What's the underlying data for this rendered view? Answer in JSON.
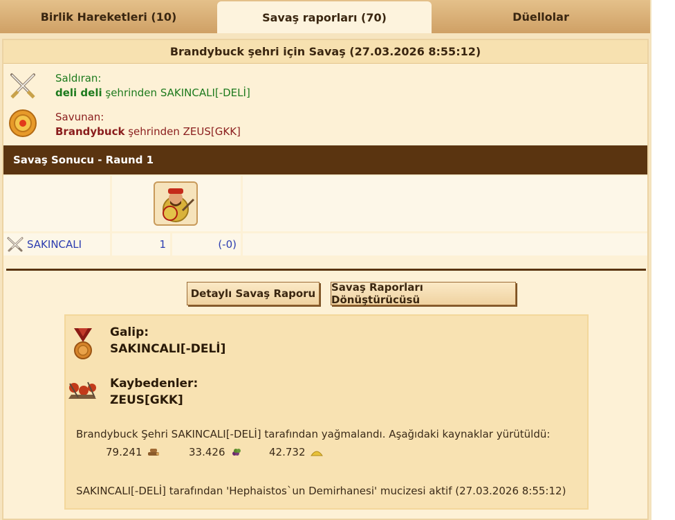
{
  "tabs": [
    {
      "label": "Birlik Hareketleri (10)"
    },
    {
      "label": "Savaş raporları (70)"
    },
    {
      "label": "Düellolar"
    }
  ],
  "report": {
    "title": "Brandybuck şehri için Savaş (27.03.2026 8:55:12)",
    "attacker": {
      "label": "Saldıran:",
      "city": "deli deli",
      "connector": " şehrinden ",
      "player": "SAKINCALI[-DELİ]"
    },
    "defender": {
      "label": "Savunan:",
      "city": "Brandybuck",
      "connector": " şehrinden ",
      "player": "ZEUS[GKK]"
    },
    "result_header": "Savaş Sonucu - Raund 1",
    "row": {
      "name": "SAKINCALI",
      "count": "1",
      "loss": "(-0)"
    },
    "buttons": {
      "detail": "Detaylı Savaş Raporu",
      "converter": "Savaş Raporları Dönüştürücüsü"
    },
    "summary": {
      "winner_label": "Galip:",
      "winner": "SAKINCALI[-DELİ]",
      "losers_label": "Kaybedenler:",
      "losers": "ZEUS[GKK]",
      "plunder_text": "Brandybuck Şehri SAKINCALI[-DELİ] tarafından yağmalandı. Aşağıdaki kaynaklar yürütüldü:",
      "resources": [
        {
          "value": "79.241",
          "icon": "wood-icon"
        },
        {
          "value": "33.426",
          "icon": "wine-icon"
        },
        {
          "value": "42.732",
          "icon": "sulfur-icon"
        }
      ],
      "wonder_text": "SAKINCALI[-DELİ] tarafından 'Hephaistos`un Demirhanesi' mucizesi aktif (27.03.2026 8:55:12)"
    }
  },
  "colors": {
    "header_bar": "#5a3410",
    "attacker": "#1d7a1d",
    "defender": "#8a1d1d",
    "link": "#2b3cb0"
  }
}
